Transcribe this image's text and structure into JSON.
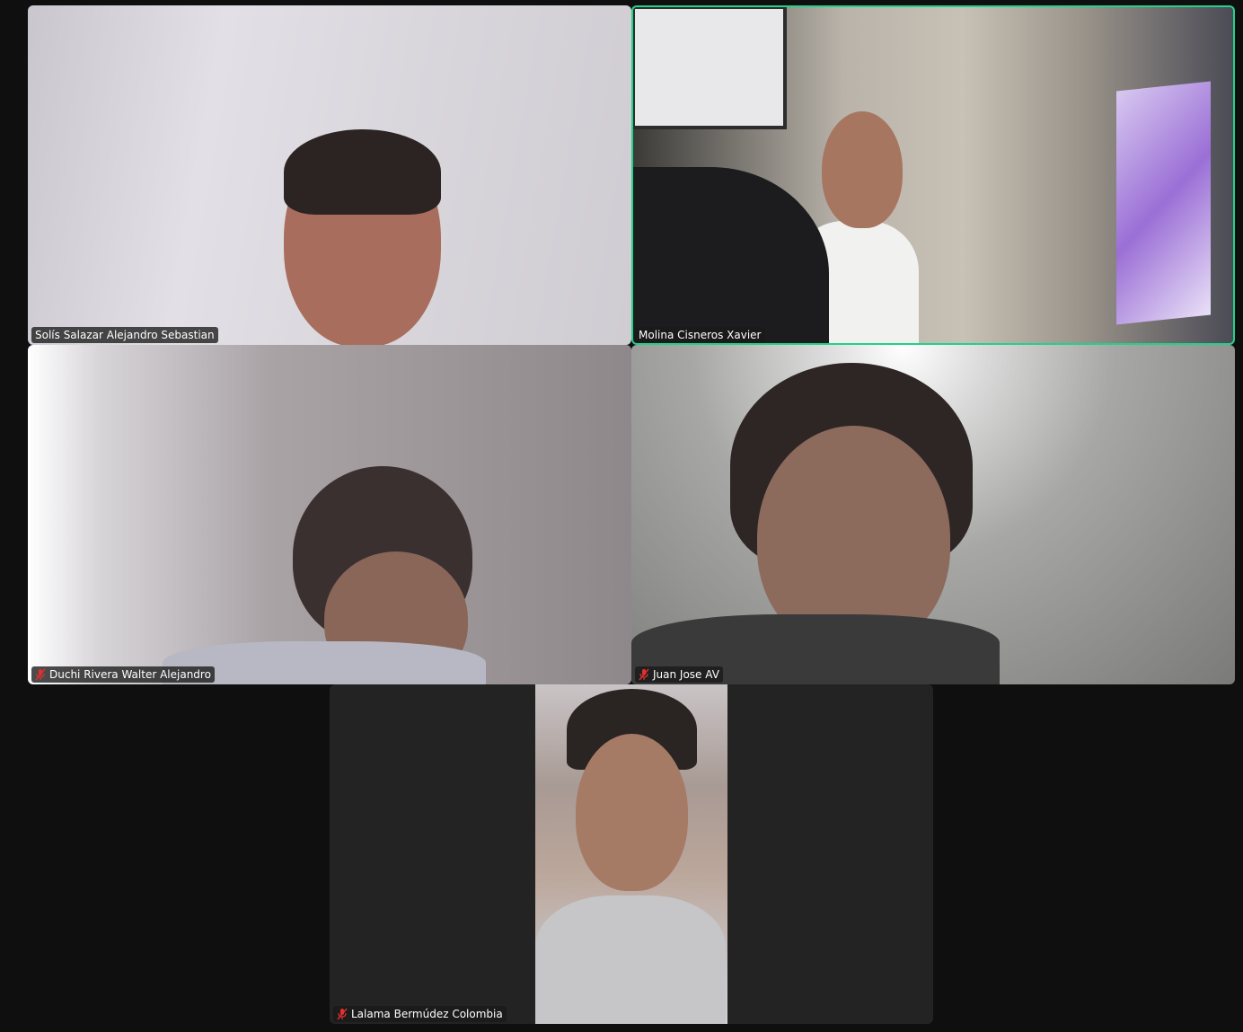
{
  "participants": [
    {
      "name": "Solís Salazar Alejandro Sebastian",
      "muted": false,
      "active": false
    },
    {
      "name": "Molina Cisneros Xavier",
      "muted": false,
      "active": true
    },
    {
      "name": "Duchi Rivera Walter Alejandro",
      "muted": true,
      "active": false
    },
    {
      "name": "Juan Jose AV",
      "muted": true,
      "active": false
    },
    {
      "name": "Lalama Bermúdez Colombia",
      "muted": true,
      "active": false
    }
  ],
  "colors": {
    "background": "#0f0f0f",
    "tile_background": "#232323",
    "active_speaker_border": "#23d18b",
    "muted_icon": "#e0302f"
  },
  "icons": {
    "muted": "mic-off-icon"
  }
}
